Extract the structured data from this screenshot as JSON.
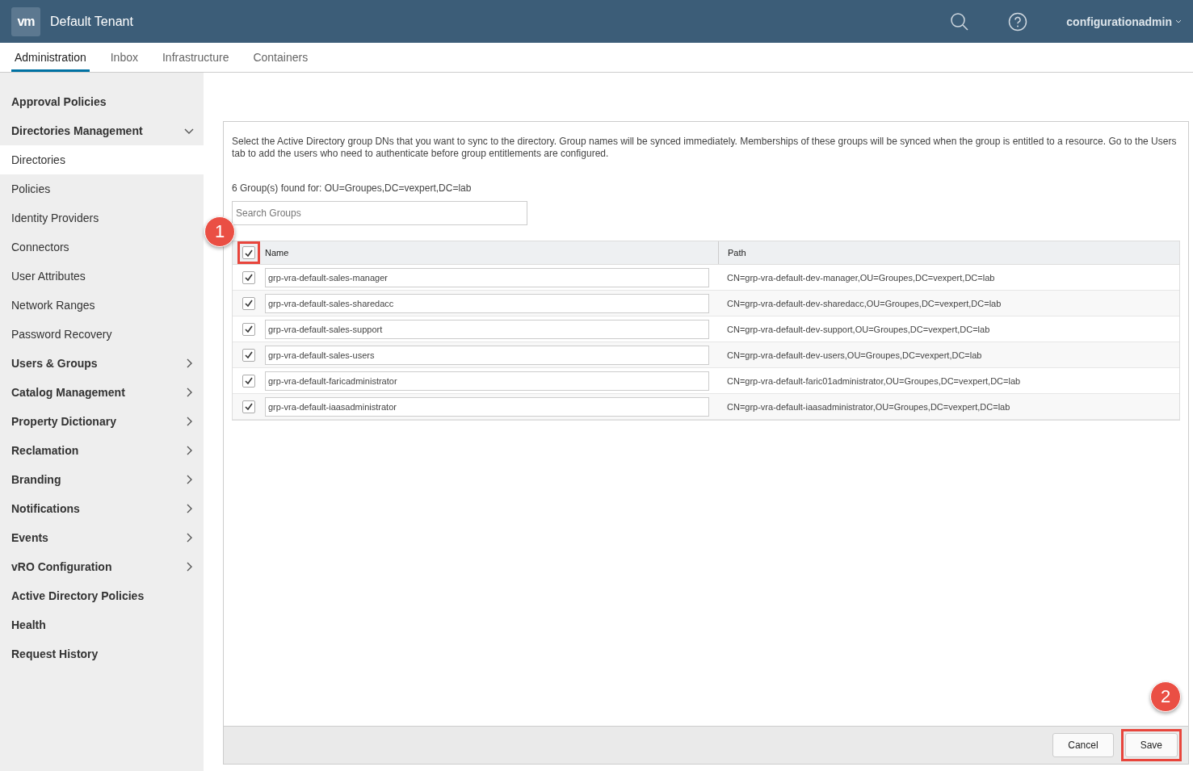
{
  "header": {
    "logo": "vm",
    "title": "Default Tenant",
    "user": "configurationadmin"
  },
  "tabs": [
    {
      "label": "Administration",
      "selected": true
    },
    {
      "label": "Inbox",
      "selected": false
    },
    {
      "label": "Infrastructure",
      "selected": false
    },
    {
      "label": "Containers",
      "selected": false
    }
  ],
  "sidebar": {
    "items": [
      {
        "label": "Approval Policies",
        "kind": "plain",
        "selected": false
      },
      {
        "label": "Directories Management",
        "kind": "group",
        "expanded": true,
        "selected": false,
        "children": [
          {
            "label": "Directories",
            "selected": true
          },
          {
            "label": "Policies",
            "selected": false
          },
          {
            "label": "Identity Providers",
            "selected": false
          },
          {
            "label": "Connectors",
            "selected": false
          },
          {
            "label": "User Attributes",
            "selected": false
          },
          {
            "label": "Network Ranges",
            "selected": false
          },
          {
            "label": "Password Recovery",
            "selected": false
          }
        ]
      },
      {
        "label": "Users & Groups",
        "kind": "group",
        "expanded": false,
        "selected": false
      },
      {
        "label": "Catalog Management",
        "kind": "group",
        "expanded": false,
        "selected": false
      },
      {
        "label": "Property Dictionary",
        "kind": "group",
        "expanded": false,
        "selected": false
      },
      {
        "label": "Reclamation",
        "kind": "group",
        "expanded": false,
        "selected": false
      },
      {
        "label": "Branding",
        "kind": "group",
        "expanded": false,
        "selected": false
      },
      {
        "label": "Notifications",
        "kind": "group",
        "expanded": false,
        "selected": false
      },
      {
        "label": "Events",
        "kind": "group",
        "expanded": false,
        "selected": false
      },
      {
        "label": "vRO Configuration",
        "kind": "group",
        "expanded": false,
        "selected": false
      },
      {
        "label": "Active Directory Policies",
        "kind": "plain",
        "selected": false
      },
      {
        "label": "Health",
        "kind": "plain",
        "selected": false
      },
      {
        "label": "Request History",
        "kind": "plain",
        "selected": false
      }
    ]
  },
  "dialog": {
    "description": "Select the Active Directory group DNs that you want to sync to the directory. Group names will be synced immediately. Memberships of these groups will be synced when the group is entitled to a resource. Go to the Users tab to add the users who need to authenticate before group entitlements are configured.",
    "found": "6 Group(s) found for: OU=Groupes,DC=vexpert,DC=lab",
    "search": {
      "placeholder": "Search Groups"
    },
    "table": {
      "select_all": {
        "checked": true,
        "highlighted": true,
        "annotation": "1"
      },
      "columns": [
        "Name",
        "Path"
      ],
      "rows": [
        {
          "checked": true,
          "name": "grp-vra-default-sales-manager",
          "path": "CN=grp-vra-default-dev-manager,OU=Groupes,DC=vexpert,DC=lab"
        },
        {
          "checked": true,
          "name": "grp-vra-default-sales-sharedacc",
          "path": "CN=grp-vra-default-dev-sharedacc,OU=Groupes,DC=vexpert,DC=lab"
        },
        {
          "checked": true,
          "name": "grp-vra-default-sales-support",
          "path": "CN=grp-vra-default-dev-support,OU=Groupes,DC=vexpert,DC=lab"
        },
        {
          "checked": true,
          "name": "grp-vra-default-sales-users",
          "path": "CN=grp-vra-default-dev-users,OU=Groupes,DC=vexpert,DC=lab"
        },
        {
          "checked": true,
          "name": "grp-vra-default-faricadministrator",
          "path": "CN=grp-vra-default-faric01administrator,OU=Groupes,DC=vexpert,DC=lab"
        },
        {
          "checked": true,
          "name": "grp-vra-default-iaasadministrator",
          "path": "CN=grp-vra-default-iaasadministrator,OU=Groupes,DC=vexpert,DC=lab"
        }
      ]
    },
    "buttons": [
      {
        "label": "Cancel"
      },
      {
        "label": "Save",
        "highlighted": true,
        "annotation": "2"
      }
    ]
  }
}
